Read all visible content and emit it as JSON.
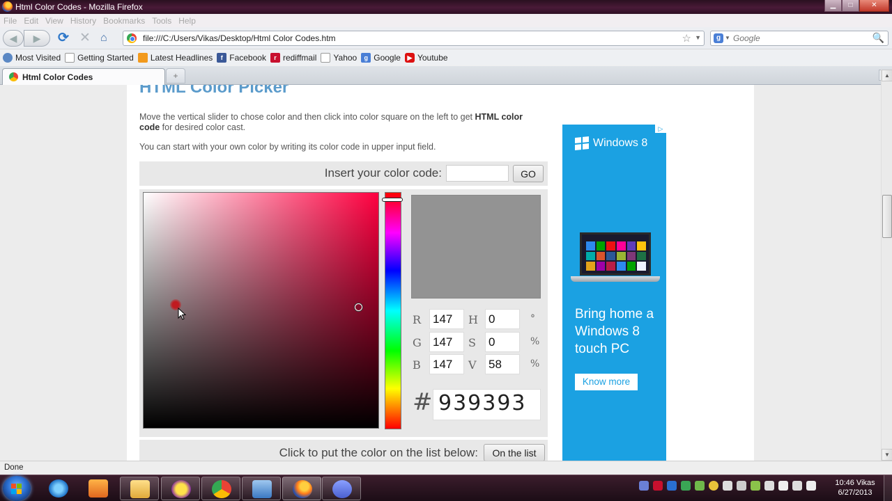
{
  "window": {
    "title": "Html Color Codes - Mozilla Firefox",
    "controls": {
      "minimize": "▁",
      "maximize": "□",
      "close": "✕"
    }
  },
  "menu": [
    "File",
    "Edit",
    "View",
    "History",
    "Bookmarks",
    "Tools",
    "Help"
  ],
  "nav": {
    "back_icon": "◀",
    "forward_icon": "▶",
    "reload_icon": "⟳",
    "stop_icon": "✕",
    "home_icon": "⌂",
    "url": "file:///C:/Users/Vikas/Desktop/Html Color Codes.htm",
    "star_icon": "☆",
    "dropdown_icon": "▼",
    "search_engine_icon": "g",
    "search_placeholder": "Google",
    "search_icon": "🔍"
  },
  "bookmarks": [
    {
      "label": "Most Visited",
      "icon": "most-visited-icon"
    },
    {
      "label": "Getting Started",
      "icon": "page-icon"
    },
    {
      "label": "Latest Headlines",
      "icon": "rss-icon"
    },
    {
      "label": "Facebook",
      "icon": "facebook-icon"
    },
    {
      "label": "rediffmail",
      "icon": "rediff-icon"
    },
    {
      "label": "Yahoo",
      "icon": "page-icon"
    },
    {
      "label": "Google",
      "icon": "google-icon"
    },
    {
      "label": "Youtube",
      "icon": "youtube-icon"
    }
  ],
  "tabs": {
    "active_label": "Html Color Codes",
    "new_tab_icon": "+",
    "tab_list_icon": "▼"
  },
  "page": {
    "title": "HTML Color Picker",
    "desc1_pre": "Move the vertical slider to chose color and then click into color square on the left to get ",
    "desc1_bold": "HTML color code",
    "desc1_post": " for desired color cast.",
    "desc2": "You can start with your own color by writing its color code in upper input field.",
    "insert_label": "Insert your color code:",
    "go_label": "GO",
    "list_label": "Click to put the color on the list below:",
    "on_list_label": "On the list"
  },
  "picker": {
    "preview_color": "#939393",
    "hue_color": "#ff0040",
    "fields": [
      {
        "label1": "R",
        "value1": "147",
        "label2": "H",
        "value2": "0",
        "unit": "°"
      },
      {
        "label1": "G",
        "value1": "147",
        "label2": "S",
        "value2": "0",
        "unit": "%"
      },
      {
        "label1": "B",
        "value1": "147",
        "label2": "V",
        "value2": "58",
        "unit": "%"
      }
    ],
    "hash": "#",
    "hex": "939393"
  },
  "ad": {
    "adchoices": "▷",
    "brand": "Windows 8",
    "headline": "Bring home a Windows 8 touch PC",
    "cta": "Know more",
    "color": "#1ba1e2"
  },
  "scrollbar": {
    "up": "▲",
    "down": "▼"
  },
  "status": "Done",
  "clock": {
    "time": "10:46 Vikas",
    "date": "6/27/2013"
  }
}
